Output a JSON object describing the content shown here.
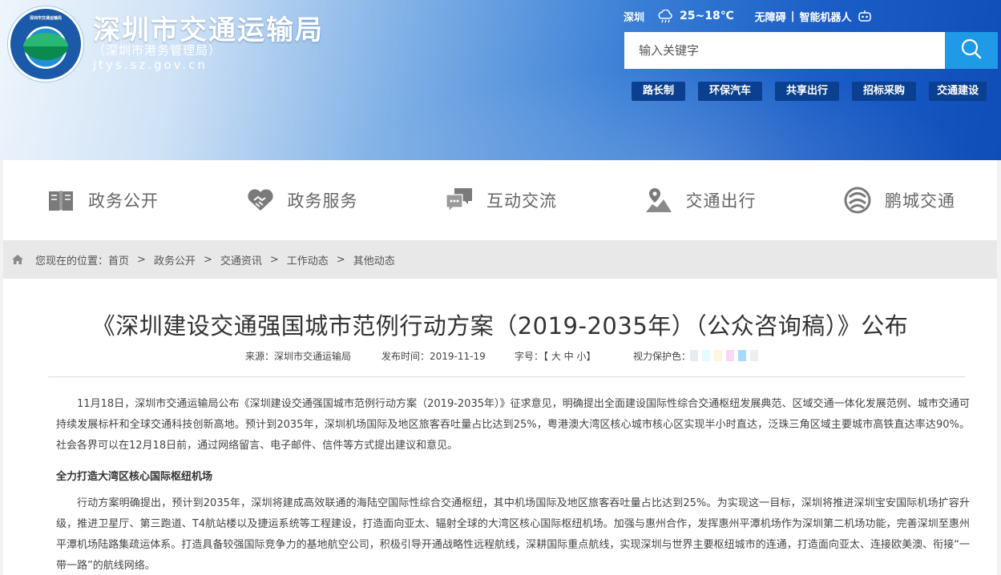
{
  "header": {
    "logo_text": "深圳市交通运输局",
    "title": "深圳市交通运输局",
    "subtitle": "（深圳市港务管理局）",
    "domain": "jtys.sz.gov.cn",
    "city": "深圳",
    "weather_icon": "cloud-rain-icon",
    "temperature": "25~18℃",
    "accessibility": "无障碍",
    "separator": "|",
    "robot": "智能机器人",
    "search_placeholder": "输入关键字",
    "quick_links": [
      "路长制",
      "环保汽车",
      "共享出行",
      "招标采购",
      "交通建设"
    ],
    "colors": {
      "quick_link_bg": "#0b3f8f",
      "search_button": "#1f9ae6"
    }
  },
  "nav": {
    "items": [
      {
        "label": "政务公开",
        "icon": "book-icon"
      },
      {
        "label": "政务服务",
        "icon": "handshake-icon"
      },
      {
        "label": "互动交流",
        "icon": "chat-icon"
      },
      {
        "label": "交通出行",
        "icon": "map-pin-icon"
      },
      {
        "label": "鹏城交通",
        "icon": "swirl-icon"
      }
    ]
  },
  "breadcrumb": {
    "prefix": "您现在的位置：",
    "items": [
      "首页",
      "政务公开",
      "交通资讯",
      "工作动态",
      "其他动态"
    ],
    "separator": ">"
  },
  "article": {
    "title": "《深圳建设交通强国城市范例行动方案（2019-2035年）（公众咨询稿）》公布",
    "source": "来源：深圳市交通运输局",
    "date": "发布时间：2019-11-19",
    "font_size_label": "字号：【 大 中 小】",
    "vision_label": "视力保护色：",
    "vision_colors": [
      "#e8ecee",
      "#e6fbfd",
      "#fbf7de",
      "#fbd6f7",
      "#a7dbfb",
      "#eeeeee"
    ],
    "paragraph1": "11月18日，深圳市交通运输局公布《深圳建设交通强国城市范例行动方案（2019-2035年）》征求意见，明确提出全面建设国际性综合交通枢纽发展典范、区域交通一体化发展范例、城市交通可持续发展标杆和全球交通科技创新高地。预计到2035年，深圳机场国际及地区旅客吞吐量占比达到25%，粤港澳大湾区核心城市核心区实现半小时直达，泛珠三角区域主要城市高铁直达率达90%。社会各界可以在12月18日前，通过网络留言、电子邮件、信件等方式提出建议和意见。",
    "subheading": "全力打造大湾区核心国际枢纽机场",
    "paragraph2": "行动方案明确提出，预计到2035年，深圳将建成高效联通的海陆空国际性综合交通枢纽，其中机场国际及地区旅客吞吐量占比达到25%。为实现这一目标，深圳将推进深圳宝安国际机场扩容升级，推进卫星厅、第三跑道、T4航站楼以及捷运系统等工程建设，打造面向亚太、辐射全球的大湾区核心国际枢纽机场。加强与惠州合作，发挥惠州平潭机场作为深圳第二机场功能，完善深圳至惠州平潭机场陆路集疏运体系。打造具备较强国际竞争力的基地航空公司，积极引导开通战略性远程航线，深耕国际重点航线，实现深圳与世界主要枢纽城市的连通，打造面向亚太、连接欧美澳、衔接“一带一路”的航线网络。"
  }
}
